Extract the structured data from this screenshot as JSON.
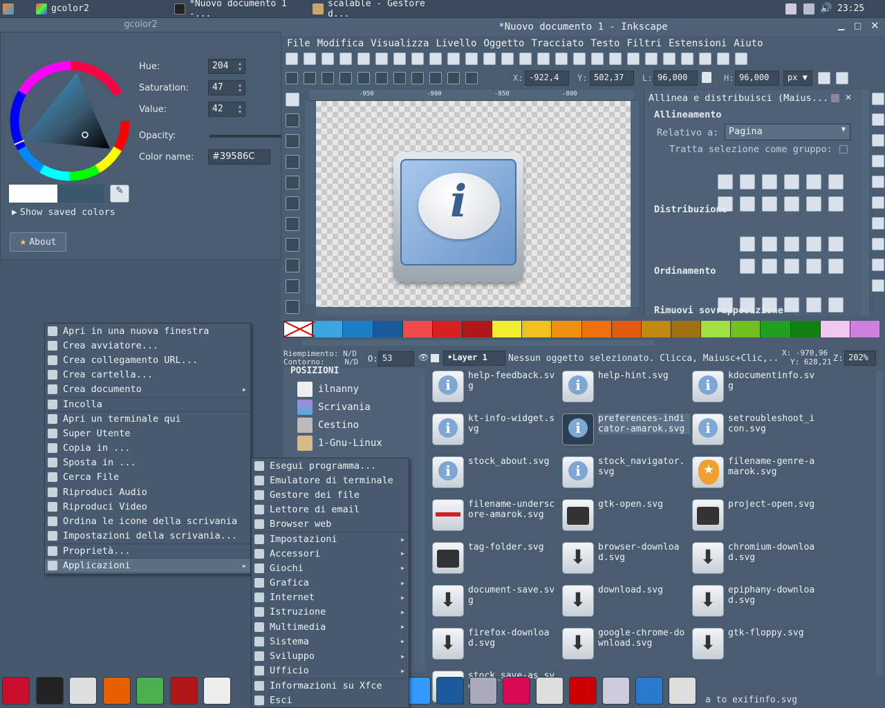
{
  "top_panel": {
    "tasks": [
      {
        "label": "gcolor2"
      },
      {
        "label": "*Nuovo documento 1 -..."
      },
      {
        "label": "scalable - Gestore d..."
      }
    ],
    "clock": "23:25"
  },
  "gcolor": {
    "title": "gcolor2",
    "hue_label": "Hue:",
    "hue": "204",
    "sat_label": "Saturation:",
    "sat": "47",
    "val_label": "Value:",
    "val": "42",
    "opacity_label": "Opacity:",
    "name_label": "Color name:",
    "name": "#39586C",
    "show_saved": "Show saved colors",
    "about": "About",
    "color": "#39586C"
  },
  "inkscape": {
    "title": "*Nuovo documento 1 - Inkscape",
    "menu": [
      "File",
      "Modifica",
      "Visualizza",
      "Livello",
      "Oggetto",
      "Tracciato",
      "Testo",
      "Filtri",
      "Estensioni",
      "Aiuto"
    ],
    "coords": {
      "x_label": "X:",
      "x": "-922,4",
      "y_label": "Y:",
      "y": "502,37",
      "w_label": "L:",
      "w": "96,000",
      "h_label": "H:",
      "h": "96,000",
      "unit": "px"
    },
    "ruler": [
      "-950",
      "-900",
      "-850",
      "-800"
    ],
    "panel": {
      "title": "Allinea e distribuisci (Maius...",
      "align_head": "Allineamento",
      "relative_label": "Relativo a:",
      "relative_value": "Pagina",
      "group_label": "Tratta selezione come gruppo:",
      "dist_head": "Distribuzione",
      "order_head": "Ordinamento",
      "overlap_head": "Rimuovi sovrapposizione"
    },
    "palette": [
      "#3aa6e0",
      "#1a7fc4",
      "#1a5a9a",
      "#f04a4a",
      "#d82020",
      "#b01818",
      "#f0f030",
      "#f0c020",
      "#f09010",
      "#f07010",
      "#e05a10",
      "#c08a10",
      "#a07010",
      "#a0e040",
      "#70c020",
      "#20a020",
      "#108010",
      "#f0c8f0",
      "#d080e0"
    ],
    "status": {
      "fill_label": "Riempimento:",
      "fill": "N/D",
      "stroke_label": "Contorno:",
      "stroke": "N/D",
      "opacity_o": "O:",
      "opacity": "53",
      "layer": "•Layer 1",
      "msg": "Nessun oggetto selezionato. Clicca, Maiusc+Clic,...",
      "x": "X: -970,96",
      "y": "Y: 628,21",
      "zoom_label": "Z:",
      "zoom": "202%"
    }
  },
  "filemanager": {
    "places_head": "POSIZIONI",
    "places": [
      "ilnanny",
      "Scrivania",
      "Cestino",
      "1-Gnu-Linux"
    ],
    "files": [
      {
        "label": "help-feedback.svg",
        "icon": "info"
      },
      {
        "label": "help-hint.svg",
        "icon": "info"
      },
      {
        "label": "kdocumentinfo.svg",
        "icon": "info"
      },
      {
        "label": "kt-info-widget.svg",
        "icon": "info"
      },
      {
        "label": "preferences-indicator-amarok.svg",
        "icon": "info-dark"
      },
      {
        "label": "setroubleshoot_icon.svg",
        "icon": "info"
      },
      {
        "label": "stock_about.svg",
        "icon": "info"
      },
      {
        "label": "stock_navigator.svg",
        "icon": "info"
      },
      {
        "label": "filename-genre-amarok.svg",
        "icon": "star"
      },
      {
        "label": "filename-underscore-amarok.svg",
        "icon": "underscore"
      },
      {
        "label": "gtk-open.svg",
        "icon": "folder"
      },
      {
        "label": "project-open.svg",
        "icon": "folder"
      },
      {
        "label": "tag-folder.svg",
        "icon": "folder"
      },
      {
        "label": "browser-download.svg",
        "icon": "download"
      },
      {
        "label": "chromium-download.svg",
        "icon": "download"
      },
      {
        "label": "document-save.svg",
        "icon": "download"
      },
      {
        "label": "download.svg",
        "icon": "download"
      },
      {
        "label": "epiphany-download.svg",
        "icon": "download"
      },
      {
        "label": "firefox-download.svg",
        "icon": "download"
      },
      {
        "label": "google-chrome-download.svg",
        "icon": "download"
      },
      {
        "label": "gtk-floppy.svg",
        "icon": "download"
      },
      {
        "label": "stock_save-as.svg",
        "icon": "download"
      }
    ],
    "status": "a to exifinfo.svg"
  },
  "context_menu": [
    "Apri in una nuova finestra",
    "Crea avviatore...",
    "Crea collegamento URL...",
    "Crea cartella...",
    "Crea documento",
    "Incolla",
    "Apri un terminale qui",
    "Super Utente",
    "Copia in ...",
    "Sposta in ...",
    "Cerca File",
    "Riproduci Audio",
    "Riproduci Video",
    "Ordina le icone della scrivania",
    "Impostazioni della scrivania...",
    "Proprietà...",
    "Applicazioni"
  ],
  "apps_menu": [
    "Esegui programma...",
    "Emulatore di terminale",
    "Gestore dei file",
    "Lettore di email",
    "Browser web",
    "Impostazioni",
    "Accessori",
    "Giochi",
    "Grafica",
    "Internet",
    "Istruzione",
    "Multimedia",
    "Sistema",
    "Sviluppo",
    "Ufficio",
    "Informazioni su Xfce",
    "Esci"
  ]
}
